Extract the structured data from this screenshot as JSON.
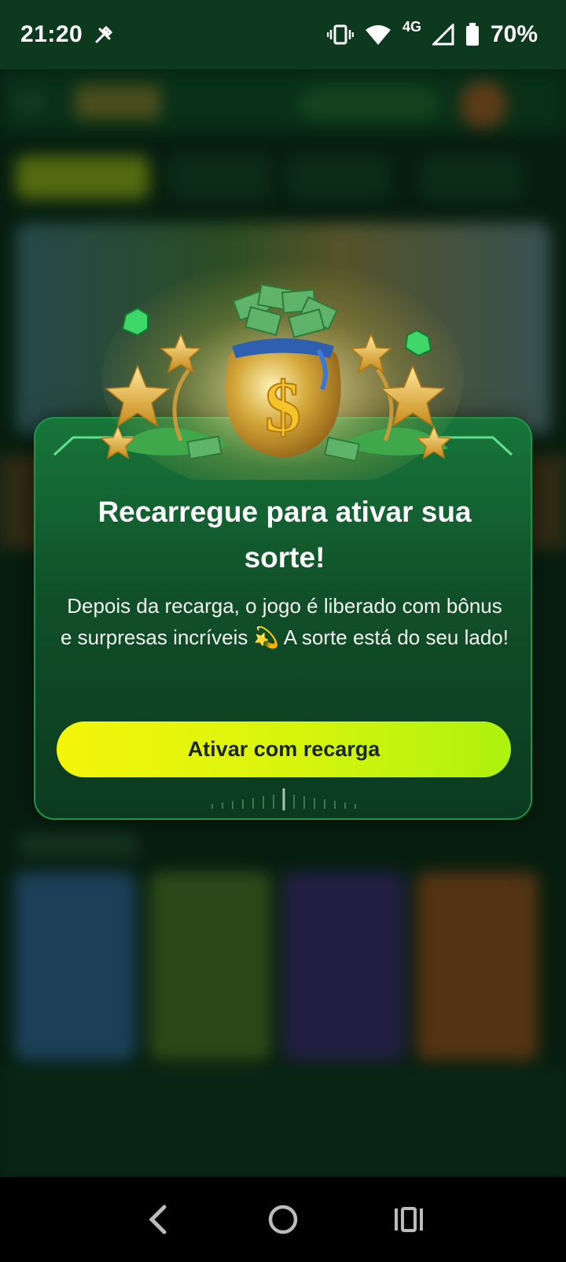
{
  "status_bar": {
    "time": "21:20",
    "network": "4G",
    "battery": "70%",
    "icons": [
      "tools-icon",
      "vibrate-icon",
      "wifi-icon",
      "signal-icon",
      "battery-icon"
    ]
  },
  "modal": {
    "title": "Recarregue para ativar sua sorte!",
    "description": "Depois da recarga, o jogo é liberado com bônus e surpresas incríveis 💫 A sorte está do seu lado!",
    "cta_label": "Ativar com recarga",
    "illustration": "money-bag-illustration"
  },
  "colors": {
    "modal_green": "#17763a",
    "cta_yellow": "#f4f50a",
    "cta_lime": "#aef20f"
  },
  "android_nav": {
    "icons": [
      "back-icon",
      "home-icon",
      "recents-icon"
    ]
  }
}
